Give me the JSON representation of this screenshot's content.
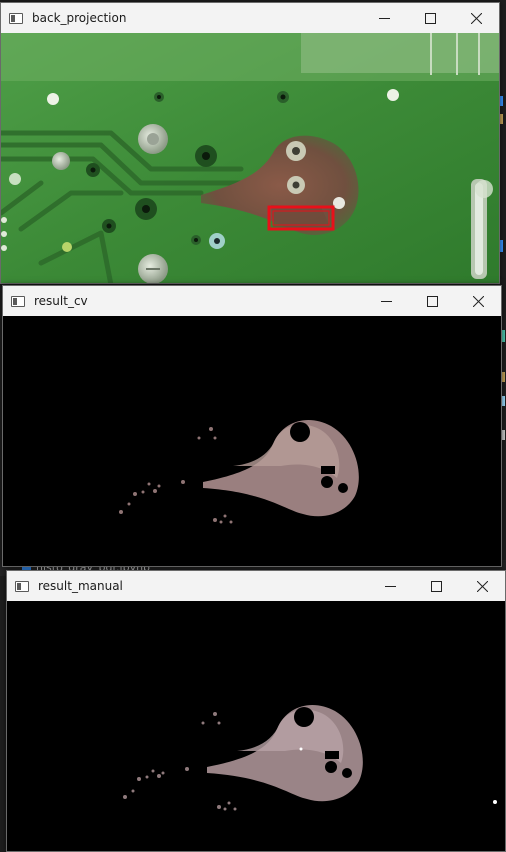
{
  "windows": [
    {
      "title": "back_projection"
    },
    {
      "title": "result_cv"
    },
    {
      "title": "result_manual"
    }
  ],
  "background": {
    "file_label": "histo_gray_bgr.ipynb",
    "icon": "notebook-file-icon",
    "accent_color": "#3794ff"
  },
  "colors": {
    "pcb_green": "#3f8f3a",
    "selection_box": "#e8101a",
    "rust_pink": "#9a7f7f"
  },
  "icons": {
    "minimize": "minimize-icon",
    "maximize": "maximize-icon",
    "close": "close-icon"
  }
}
